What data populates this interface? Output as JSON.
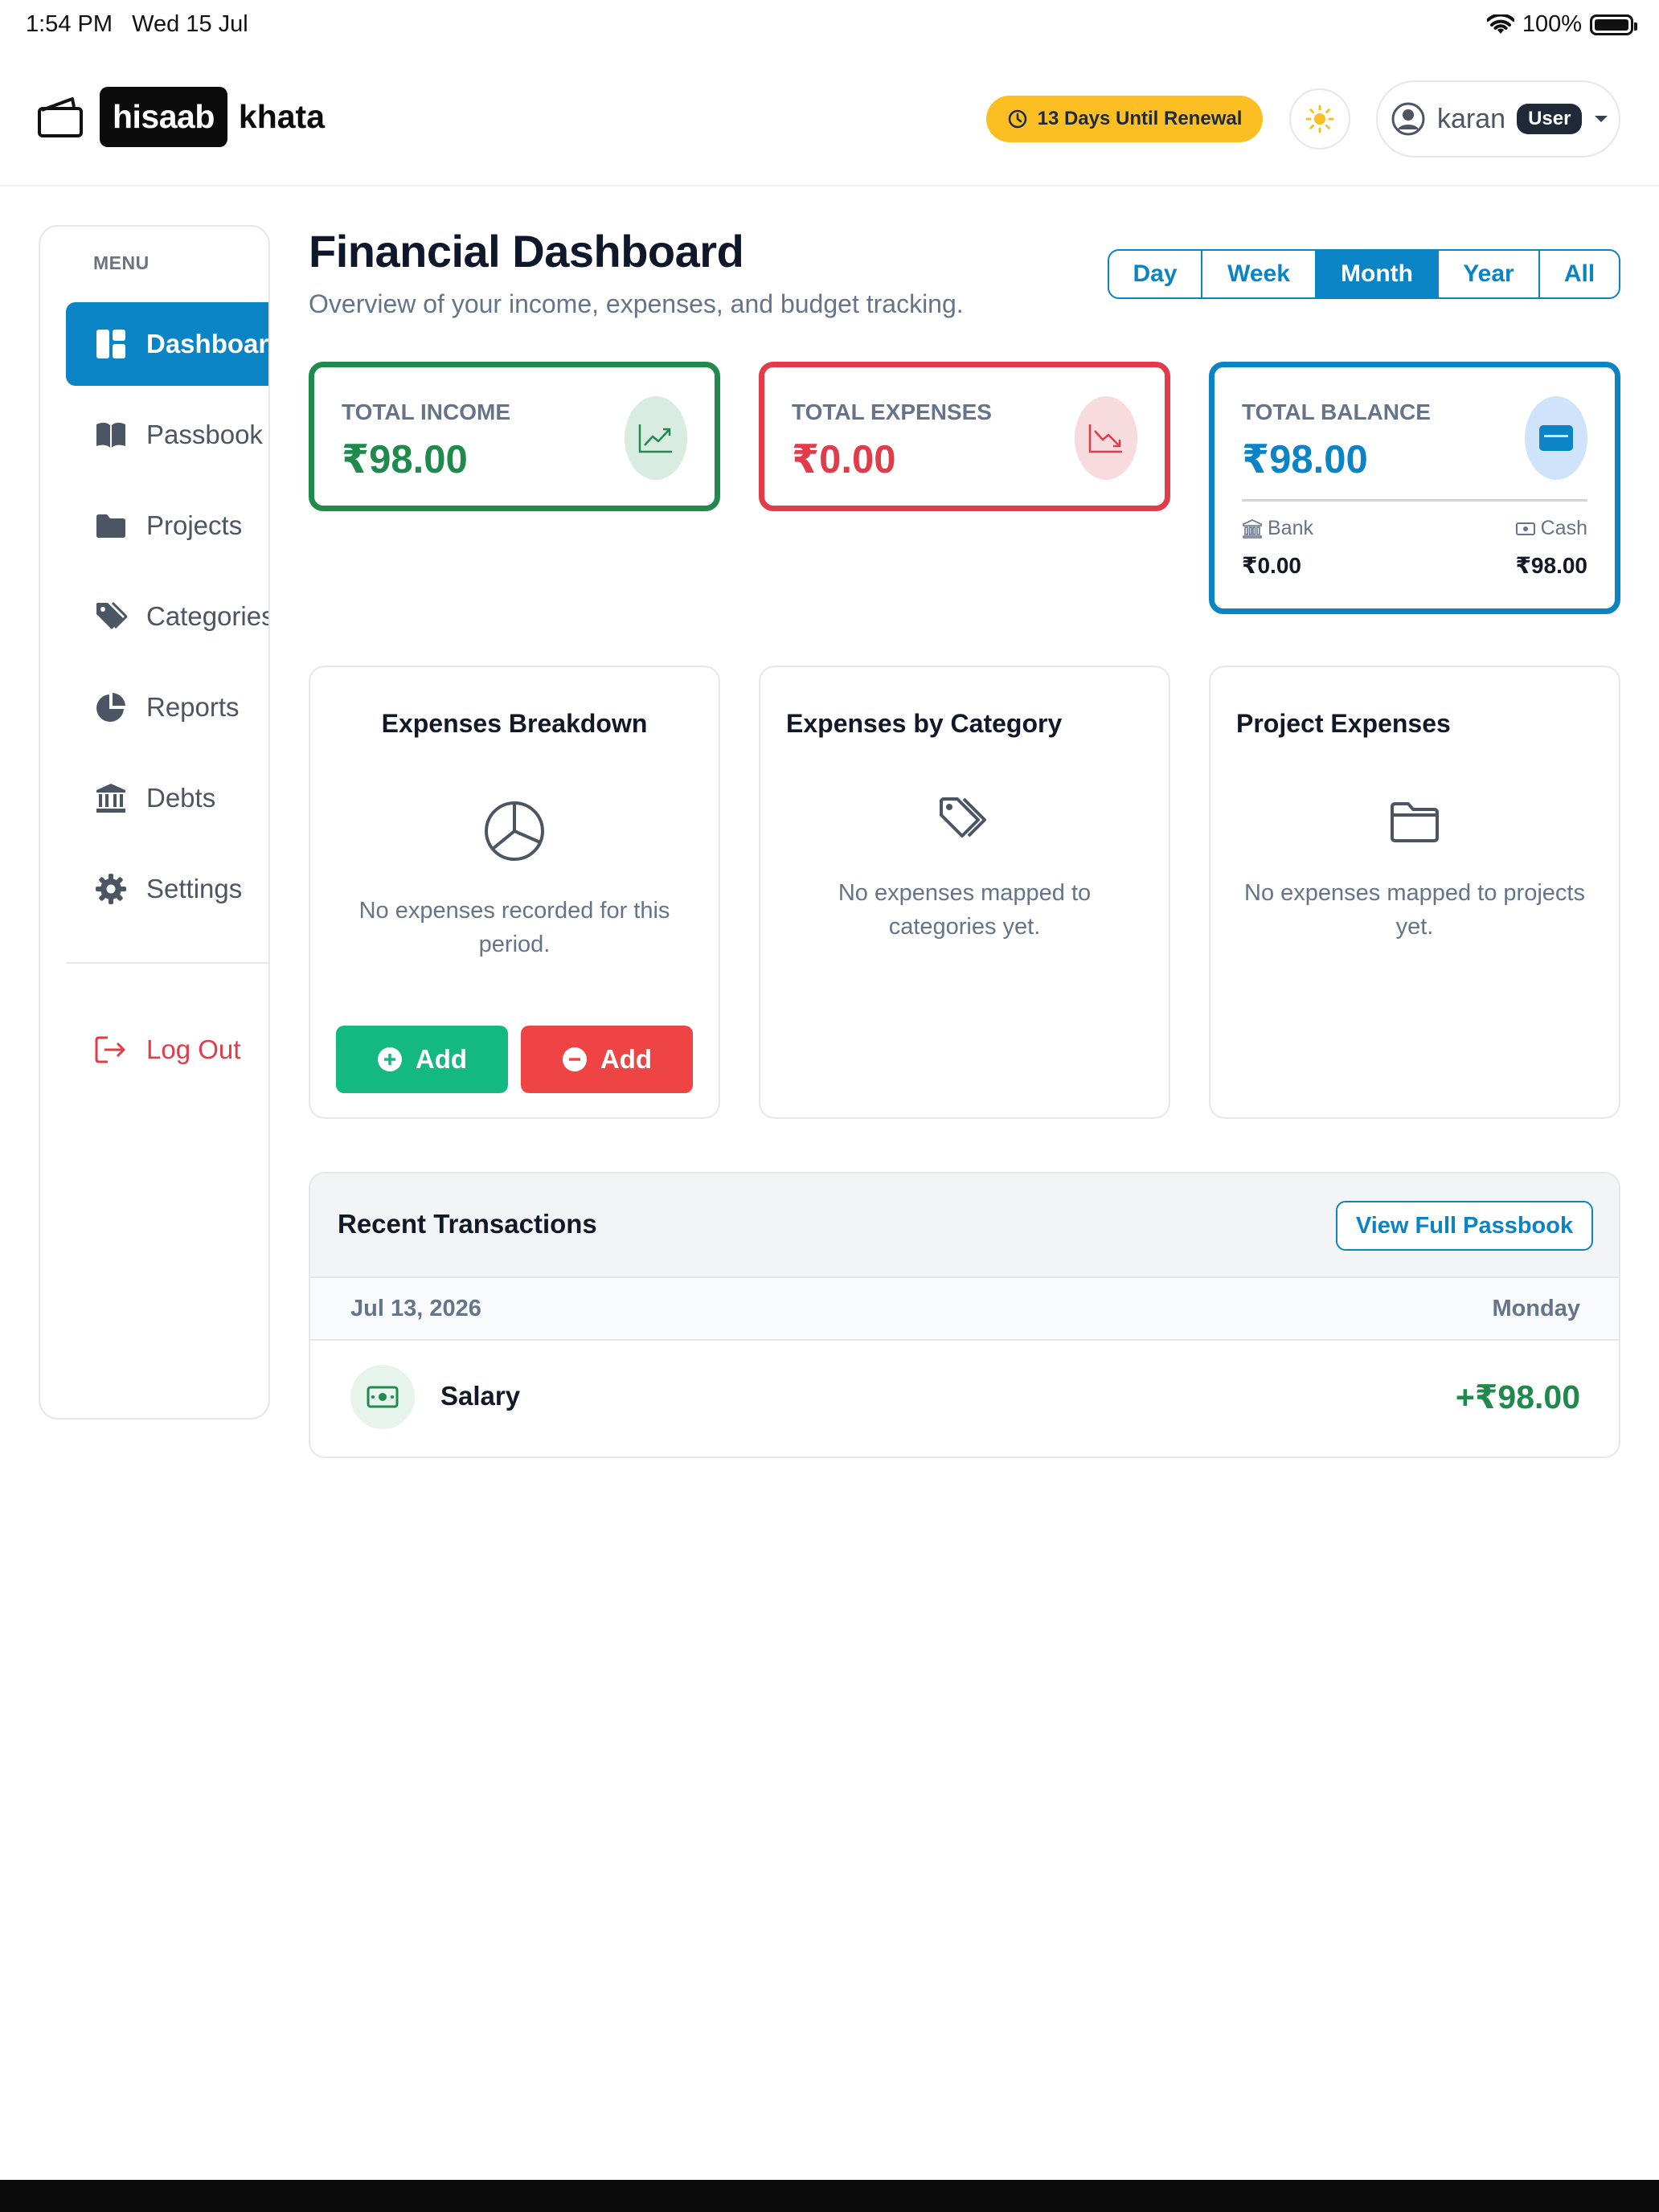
{
  "status_bar": {
    "time": "1:54 PM",
    "date": "Wed 15 Jul",
    "battery": "100%"
  },
  "brand": {
    "part1": "hisaab",
    "part2": "khata"
  },
  "header": {
    "renewal": "13 Days Until Renewal",
    "user_name": "karan",
    "user_role": "User"
  },
  "sidebar": {
    "menu_label": "MENU",
    "items": [
      {
        "label": "Dashboard",
        "icon": "dashboard-icon",
        "active": true
      },
      {
        "label": "Passbook",
        "icon": "book-icon"
      },
      {
        "label": "Projects",
        "icon": "folder-icon"
      },
      {
        "label": "Categories",
        "icon": "tag-icon"
      },
      {
        "label": "Reports",
        "icon": "pie-chart-icon"
      },
      {
        "label": "Debts",
        "icon": "bank-icon"
      },
      {
        "label": "Settings",
        "icon": "gear-icon"
      }
    ],
    "logout": "Log Out"
  },
  "main": {
    "title": "Financial Dashboard",
    "subtitle": "Overview of your income, expenses, and budget tracking.",
    "periods": [
      "Day",
      "Week",
      "Month",
      "Year",
      "All"
    ],
    "active_period": "Month",
    "stats": {
      "income": {
        "label": "TOTAL INCOME",
        "value": "₹98.00"
      },
      "expenses": {
        "label": "TOTAL EXPENSES",
        "value": "₹0.00"
      },
      "balance": {
        "label": "TOTAL BALANCE",
        "value": "₹98.00",
        "bank_label": "Bank",
        "bank_value": "₹0.00",
        "cash_label": "Cash",
        "cash_value": "₹98.00"
      }
    },
    "cards": {
      "breakdown": {
        "title": "Expenses Breakdown",
        "message": "No expenses recorded for this period.",
        "add_income_label": "Add",
        "add_expense_label": "Add"
      },
      "by_category": {
        "title": "Expenses by Category",
        "message": "No expenses mapped to categories yet."
      },
      "projects": {
        "title": "Project Expenses",
        "message": "No expenses mapped to projects yet."
      }
    },
    "recent": {
      "title": "Recent Transactions",
      "view_button": "View Full Passbook",
      "date": "Jul 13, 2026",
      "weekday": "Monday",
      "transactions": [
        {
          "name": "Salary",
          "amount": "+₹98.00"
        }
      ]
    }
  },
  "colors": {
    "primary": "#0b84c6",
    "income": "#1f8a4c",
    "expense": "#e23b4a",
    "renewal_badge": "#fbbf24",
    "add_income_btn": "#13b981",
    "add_expense_btn": "#ef4444"
  }
}
